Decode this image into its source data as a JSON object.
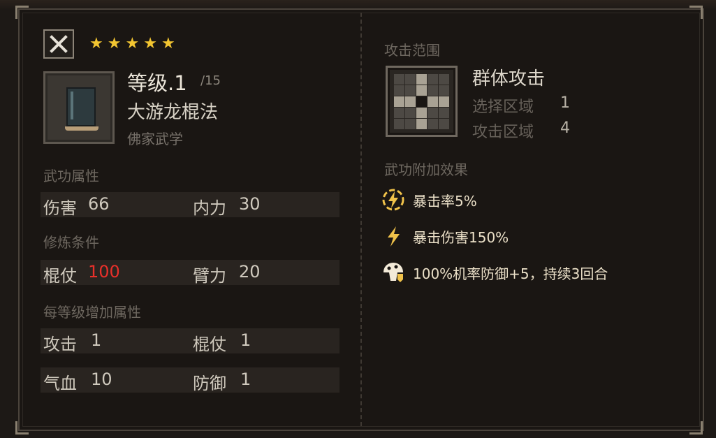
{
  "skill": {
    "level": "等级.1",
    "level_max": "/15",
    "name": "大游龙棍法",
    "school": "佛家武学",
    "stars": 5
  },
  "sections": {
    "attributes": "武功属性",
    "requirements": "修炼条件",
    "per_level": "每等级增加属性"
  },
  "attributes": [
    {
      "label": "伤害",
      "value": "66"
    },
    {
      "label": "内力",
      "value": "30"
    }
  ],
  "requirements": [
    {
      "label": "棍仗",
      "value": "100",
      "status": "insufficient"
    },
    {
      "label": "臂力",
      "value": "20"
    }
  ],
  "per_level": [
    {
      "label": "攻击",
      "value": "1"
    },
    {
      "label": "棍仗",
      "value": "1"
    },
    {
      "label": "气血",
      "value": "10"
    },
    {
      "label": "防御",
      "value": "1"
    }
  ],
  "range": {
    "title": "攻击范围",
    "name": "群体攻击",
    "select_label": "选择区域",
    "select_value": "1",
    "attack_label": "攻击区域",
    "attack_value": "4"
  },
  "effects_title": "武功附加效果",
  "effects": [
    {
      "icon": "lightning-circle-icon",
      "text": "暴击率5%"
    },
    {
      "icon": "lightning-icon",
      "text": "暴击伤害150%"
    },
    {
      "icon": "mushroom-shield-icon",
      "text": "100%机率防御+5，持续3回合"
    }
  ],
  "colors": {
    "star": "#f2c531",
    "warning": "#e8302a",
    "effect_icon": "#f0c24a"
  }
}
